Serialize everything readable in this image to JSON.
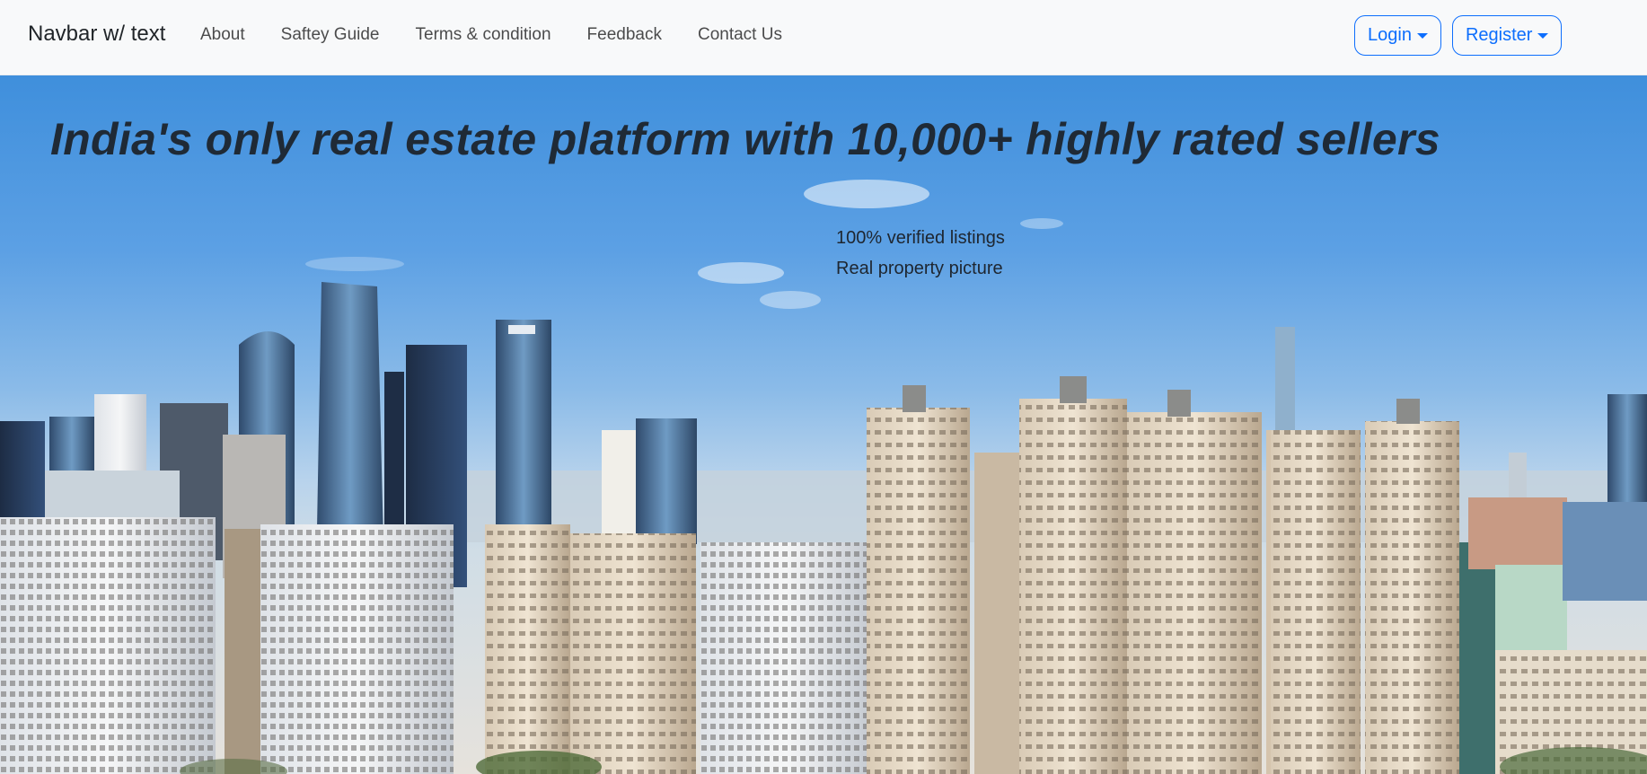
{
  "navbar": {
    "brand": "Navbar w/ text",
    "links": [
      "About",
      "Saftey Guide",
      "Terms & condition",
      "Feedback",
      "Contact Us"
    ],
    "login_label": "Login",
    "register_label": "Register"
  },
  "hero": {
    "headline": "India's only real estate platform with 10,000+ highly rated sellers",
    "features": [
      "100% verified listings",
      "Real property picture"
    ]
  },
  "colors": {
    "accent": "#0d6efd",
    "navbar_bg": "#f8f9fa"
  },
  "icons": {
    "login_caret": "chevron-down-icon",
    "register_caret": "chevron-down-icon"
  }
}
